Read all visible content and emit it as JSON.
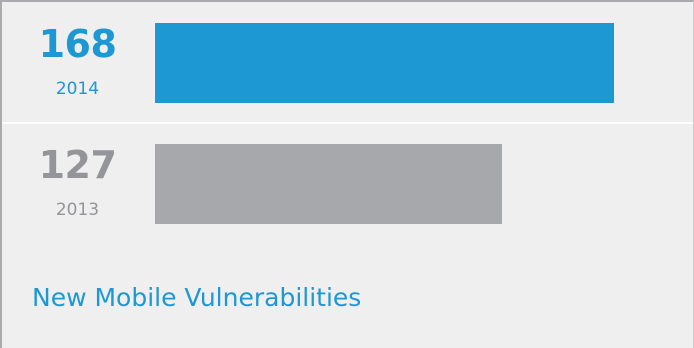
{
  "chart_data": {
    "type": "bar",
    "orientation": "horizontal",
    "title": "New Mobile Vulnerabilities",
    "categories": [
      "2014",
      "2013"
    ],
    "values": [
      168,
      127
    ],
    "value_labels": [
      "168",
      "127"
    ],
    "xlim": [
      0,
      192
    ],
    "grid": false,
    "legend": "none"
  },
  "colors": {
    "accent": "#1e98d3",
    "muted_bar": "#a6a8ab",
    "muted_text": "#939598",
    "background": "#efefef",
    "divider": "#ffffff"
  }
}
